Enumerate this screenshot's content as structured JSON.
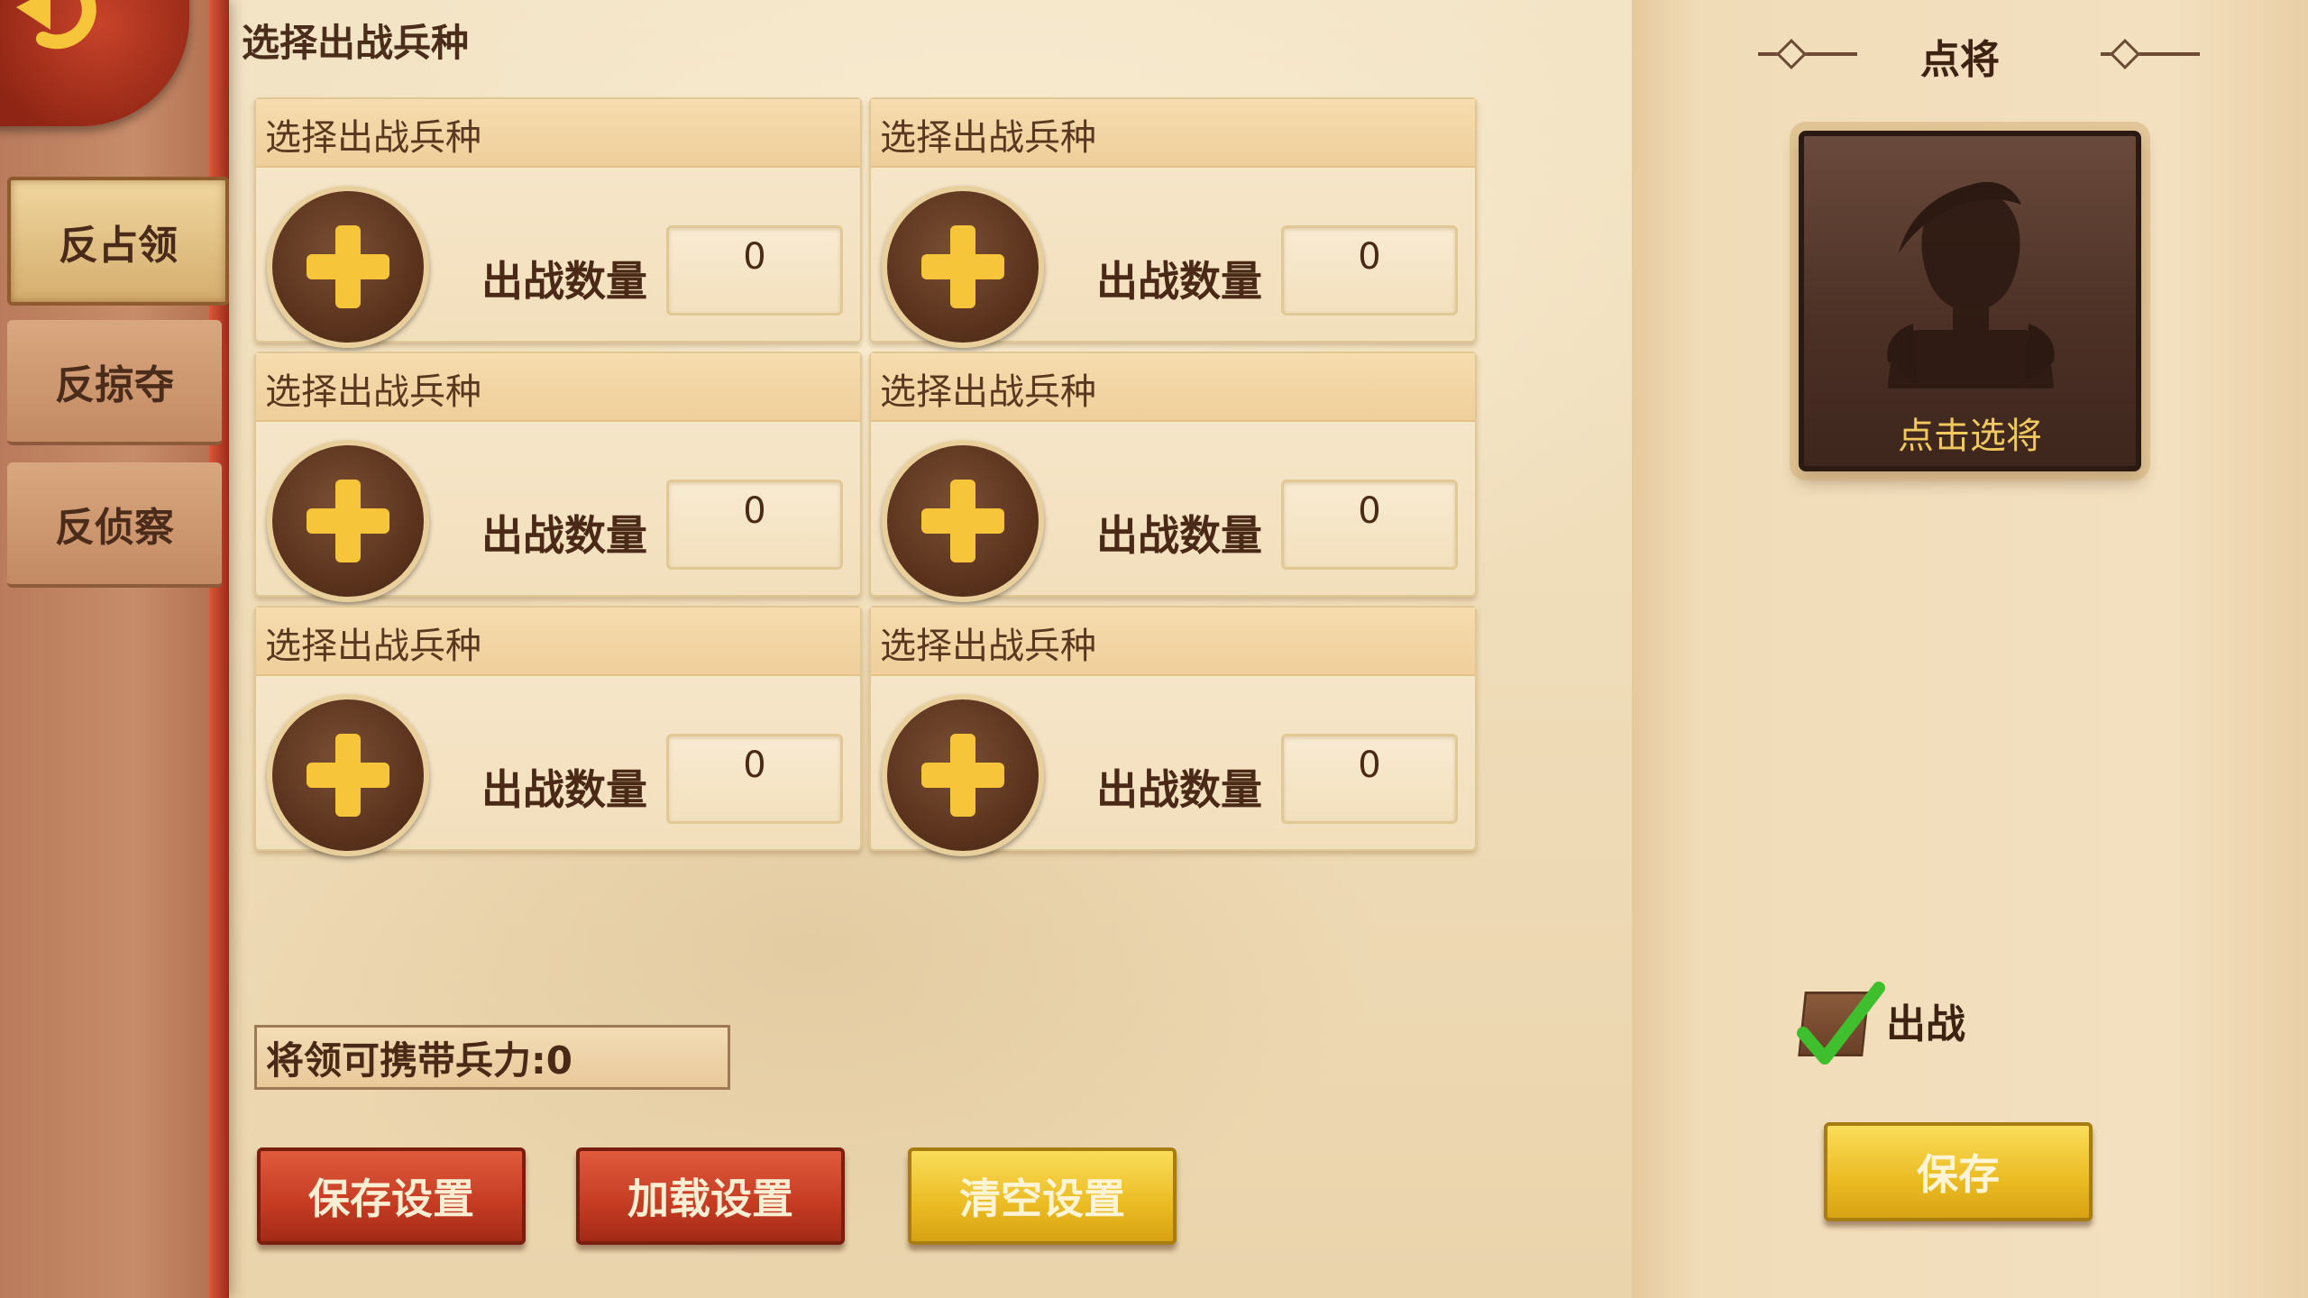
{
  "page_title": "选择出战兵种",
  "sidebar": {
    "items": [
      {
        "label": "反占领",
        "active": true
      },
      {
        "label": "反掠夺",
        "active": false
      },
      {
        "label": "反侦察",
        "active": false
      }
    ]
  },
  "slots": [
    {
      "title": "选择出战兵种",
      "qty_label": "出战数量",
      "qty": "0"
    },
    {
      "title": "选择出战兵种",
      "qty_label": "出战数量",
      "qty": "0"
    },
    {
      "title": "选择出战兵种",
      "qty_label": "出战数量",
      "qty": "0"
    },
    {
      "title": "选择出战兵种",
      "qty_label": "出战数量",
      "qty": "0"
    },
    {
      "title": "选择出战兵种",
      "qty_label": "出战数量",
      "qty": "0"
    },
    {
      "title": "选择出战兵种",
      "qty_label": "出战数量",
      "qty": "0"
    }
  ],
  "capacity_text": "将领可携带兵力:0",
  "buttons": {
    "save_settings": "保存设置",
    "load_settings": "加载设置",
    "clear_settings": "清空设置"
  },
  "right_panel": {
    "title": "点将",
    "general_hint": "点击选将",
    "deploy_label": "出战",
    "deploy_checked": true,
    "save": "保存"
  },
  "colors": {
    "accent_yellow": "#f7c53a",
    "red_button": "#c43b22",
    "parchment": "#f3e0bf"
  }
}
